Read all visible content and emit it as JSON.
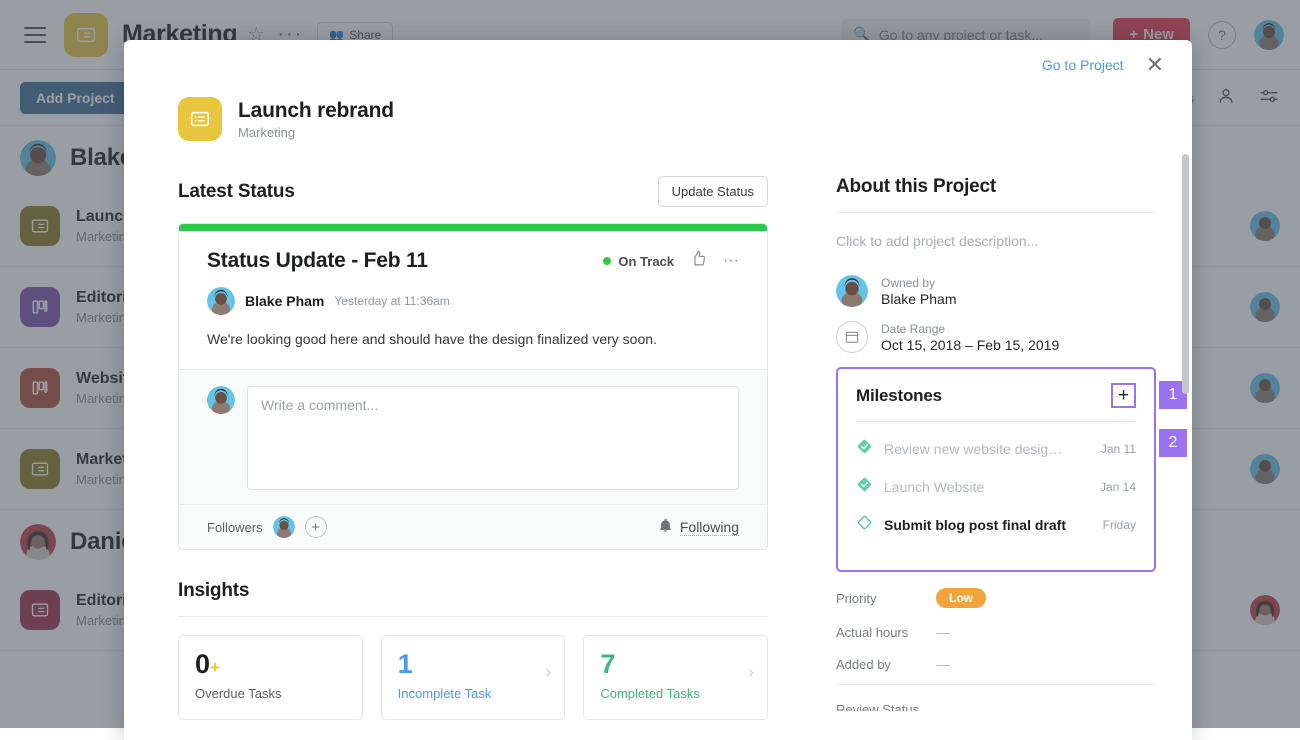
{
  "background": {
    "topbar": {
      "project_icon": "list-icon",
      "title": "Marketing",
      "star": "☆",
      "more": "···",
      "share_label": "Share",
      "search_placeholder": "Go to any project or task...",
      "new_label": "New",
      "help_label": "?"
    },
    "subbar": {
      "add_project_label": "Add Project",
      "fields_label": "Fields"
    },
    "groups": [
      {
        "name": "Blake",
        "rows": [
          {
            "title": "Launch rebrand",
            "subtitle": "Marketing",
            "icon_color": "#8c7d20",
            "icon": "list-icon"
          },
          {
            "title": "Editorial Calendar",
            "subtitle": "Marketing",
            "icon_color": "#7b52ab",
            "icon": "board-icon"
          },
          {
            "title": "Website Redesign",
            "subtitle": "Marketing",
            "icon_color": "#ad5136",
            "icon": "board-icon"
          },
          {
            "title": "Marketing Plan",
            "subtitle": "Marketing",
            "icon_color": "#8c7d20",
            "icon": "list-icon"
          }
        ]
      },
      {
        "name": "Danielle",
        "rows": [
          {
            "title": "Editorial Calendar",
            "subtitle": "Marketing",
            "icon_color": "#9e2f4d",
            "icon": "list-icon"
          }
        ]
      }
    ]
  },
  "modal": {
    "goto_project_label": "Go to Project",
    "close_label": "✕",
    "project_title": "Launch rebrand",
    "project_team": "Marketing",
    "latest_status": {
      "section_title": "Latest Status",
      "update_button": "Update Status",
      "card_title": "Status Update - Feb 11",
      "status_label": "On Track",
      "status_color": "#2ec84c",
      "author": "Blake Pham",
      "timestamp": "Yesterday at 11:36am",
      "body": "We're looking good here and should have the design finalized very soon."
    },
    "comment": {
      "placeholder": "Write a comment...",
      "followers_label": "Followers",
      "add_follower": "+",
      "following_label": "Following"
    },
    "insights": {
      "section_title": "Insights",
      "cards": [
        {
          "number": "0",
          "suffix": "+",
          "label": "Overdue Tasks",
          "number_color": "#1e1f21",
          "label_color": "#5b5f63",
          "chevron": false
        },
        {
          "number": "1",
          "suffix": "",
          "label": "Incomplete Task",
          "number_color": "#4a9ae8",
          "label_color": "#4a9ae8",
          "chevron": true
        },
        {
          "number": "7",
          "suffix": "",
          "label": "Completed Tasks",
          "number_color": "#3cb878",
          "label_color": "#3cb878",
          "chevron": true
        }
      ]
    },
    "about": {
      "section_title": "About this Project",
      "description_placeholder": "Click to add project description...",
      "owned_by_label": "Owned by",
      "owned_by_value": "Blake Pham",
      "date_range_label": "Date Range",
      "date_range_value": "Oct 15, 2018 – Feb 15, 2019"
    },
    "milestones": {
      "title": "Milestones",
      "add_label": "+",
      "accent_color": "#9b72f2",
      "items": [
        {
          "name": "Review new website desig…",
          "date": "Jan 11",
          "done": true
        },
        {
          "name": "Launch Website",
          "date": "Jan 14",
          "done": true
        },
        {
          "name": "Submit blog post final draft",
          "date": "Friday",
          "done": false
        }
      ],
      "annotations": [
        {
          "id": "1"
        },
        {
          "id": "2"
        }
      ]
    },
    "fields": [
      {
        "label": "Priority",
        "value": "Low",
        "type": "pill",
        "color": "#f2a33c"
      },
      {
        "label": "Actual hours",
        "value": "—",
        "type": "dash"
      },
      {
        "label": "Added by",
        "value": "—",
        "type": "dash"
      },
      {
        "label": "Review Status",
        "value": "",
        "type": "cut"
      }
    ]
  }
}
